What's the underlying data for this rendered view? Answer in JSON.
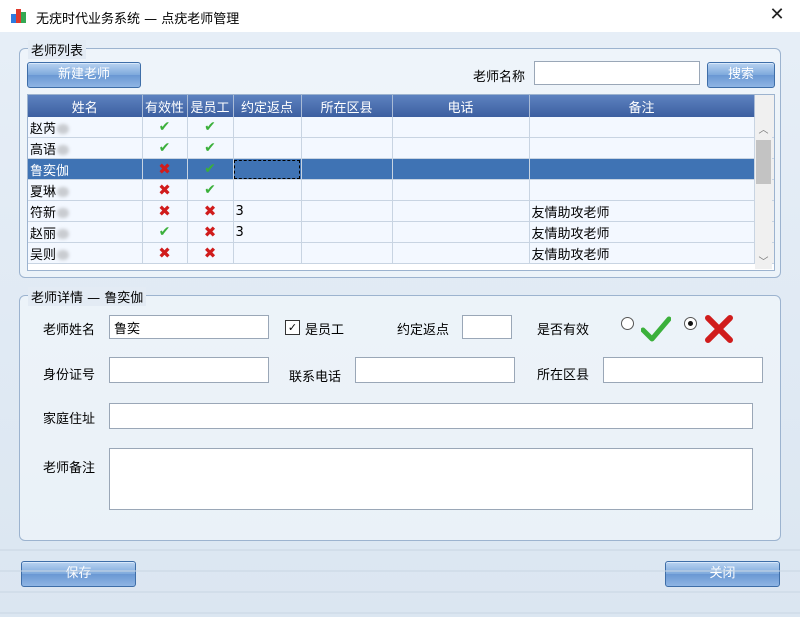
{
  "window": {
    "title": "无疣时代业务系统 — 点疣老师管理"
  },
  "list_group": {
    "title": "老师列表",
    "new_button": "新建老师",
    "search_label": "老师名称",
    "search_value": "",
    "search_button": "搜索"
  },
  "table": {
    "columns": [
      "姓名",
      "有效性",
      "是员工",
      "约定返点",
      "所在区县",
      "电话",
      "备注"
    ],
    "rows": [
      {
        "name": "赵芮",
        "valid": true,
        "employee": true,
        "rebate": "",
        "district": "",
        "phone": "",
        "note": "",
        "selected": false
      },
      {
        "name": "高语",
        "valid": true,
        "employee": true,
        "rebate": "",
        "district": "",
        "phone": "",
        "note": "",
        "selected": false
      },
      {
        "name": "鲁奕伽",
        "valid": false,
        "employee": true,
        "rebate": "",
        "district": "",
        "phone": "",
        "note": "",
        "selected": true
      },
      {
        "name": "夏琳",
        "valid": false,
        "employee": true,
        "rebate": "",
        "district": "",
        "phone": "",
        "note": "",
        "selected": false
      },
      {
        "name": "符新",
        "valid": false,
        "employee": false,
        "rebate": "3",
        "district": "",
        "phone": "",
        "note": "友情助攻老师",
        "selected": false
      },
      {
        "name": "赵丽",
        "valid": true,
        "employee": false,
        "rebate": "3",
        "district": "",
        "phone": "",
        "note": "友情助攻老师",
        "selected": false
      },
      {
        "name": "吴则",
        "valid": false,
        "employee": false,
        "rebate": "",
        "district": "",
        "phone": "",
        "note": "友情助攻老师",
        "selected": false
      }
    ]
  },
  "detail": {
    "title": "老师详情 — 鲁奕伽",
    "name_label": "老师姓名",
    "name_value": "鲁奕",
    "employee_label": "是员工",
    "employee_checked": true,
    "rebate_label": "约定返点",
    "rebate_value": "",
    "valid_label": "是否有效",
    "valid_value": false,
    "id_label": "身份证号",
    "id_value": "",
    "phone_label": "联系电话",
    "phone_value": "",
    "district_label": "所在区县",
    "district_value": "",
    "address_label": "家庭住址",
    "address_value": "",
    "note_label": "老师备注",
    "note_value": ""
  },
  "footer": {
    "save_button": "保存",
    "close_button": "关闭"
  },
  "icons": {
    "valid": "check-icon",
    "invalid": "cross-icon",
    "close": "close-icon",
    "logo": "app-logo-icon"
  },
  "colors": {
    "header": "#3c5fa0",
    "selected_row": "#3f73b4",
    "check": "#3bb03b",
    "cross": "#d01c1c"
  }
}
